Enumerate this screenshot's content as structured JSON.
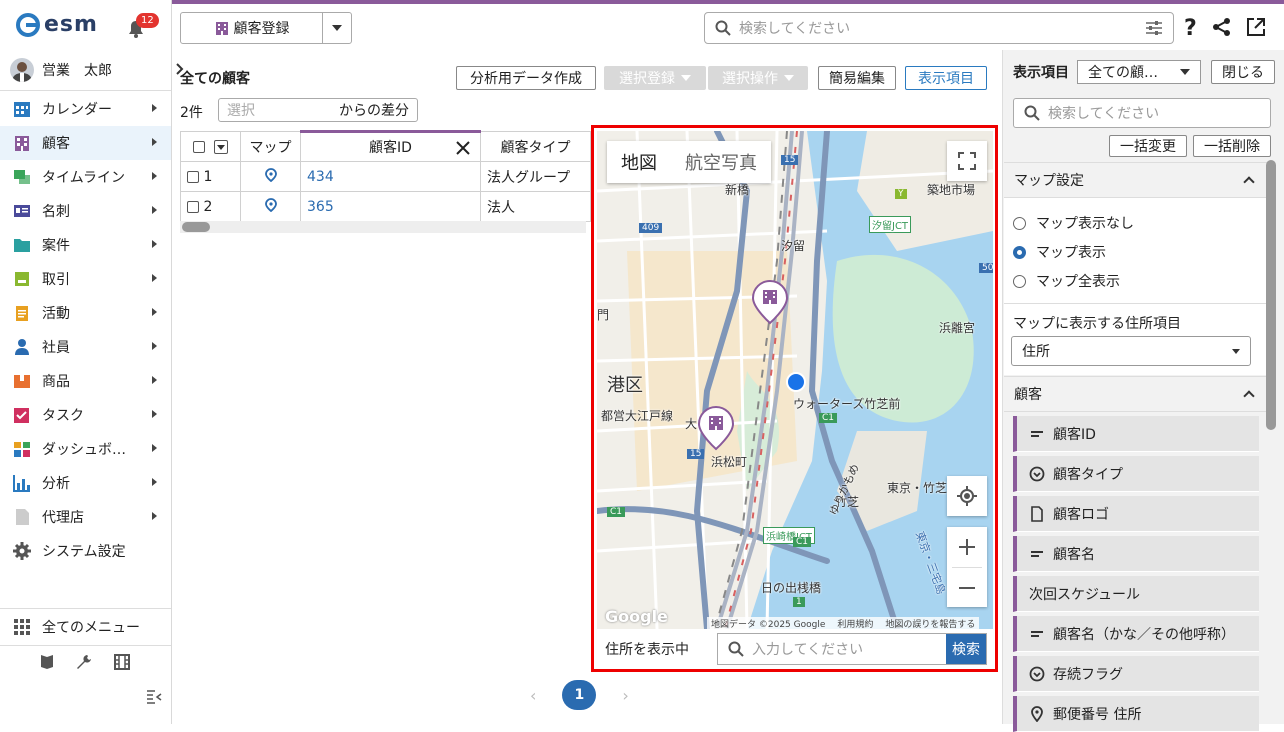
{
  "app": {
    "logo_text": "esm",
    "notifications": "12",
    "user_name": "営業　太郎"
  },
  "nav": [
    {
      "label": "カレンダー",
      "icon": "calendar-icon",
      "color": "#2a7ac0"
    },
    {
      "label": "顧客",
      "icon": "building-icon",
      "color": "#8a5a9a",
      "active": true
    },
    {
      "label": "タイムライン",
      "icon": "chat-icon",
      "color": "#3aa55a"
    },
    {
      "label": "名刺",
      "icon": "business-card-icon",
      "color": "#4a4a9a"
    },
    {
      "label": "案件",
      "icon": "folder-icon",
      "color": "#2aa0a0"
    },
    {
      "label": "取引",
      "icon": "deal-icon",
      "color": "#8ab830"
    },
    {
      "label": "活動",
      "icon": "clipboard-icon",
      "color": "#e8a020"
    },
    {
      "label": "社員",
      "icon": "person-icon",
      "color": "#2a6bb0"
    },
    {
      "label": "商品",
      "icon": "product-icon",
      "color": "#e87030"
    },
    {
      "label": "タスク",
      "icon": "task-icon",
      "color": "#d03060"
    },
    {
      "label": "ダッシュボ…",
      "icon": "dashboard-icon",
      "color": "#e8a020"
    },
    {
      "label": "分析",
      "icon": "chart-icon",
      "color": "#2a7ac0"
    },
    {
      "label": "代理店",
      "icon": "document-icon",
      "color": "#aaaaaa"
    },
    {
      "label": "システム設定",
      "icon": "gear-icon",
      "color": "#555555",
      "noarrow": true
    }
  ],
  "all_menu": "全てのメニュー",
  "toolbar": {
    "register": "顧客登録",
    "search_placeholder": "検索してください"
  },
  "list": {
    "title": "全ての顧客",
    "count": "2件",
    "diff_placeholder": "選択",
    "diff_label": "からの差分",
    "buttons": {
      "analysis": "分析用データ作成",
      "select_register": "選択登録",
      "select_operate": "選択操作",
      "quick_edit": "簡易編集",
      "display_items": "表示項目"
    },
    "columns": [
      "マップ",
      "顧客ID",
      "顧客タイプ"
    ],
    "rows": [
      {
        "no": "1",
        "id": "434",
        "type": "法人グループ"
      },
      {
        "no": "2",
        "id": "365",
        "type": "法人"
      }
    ]
  },
  "map": {
    "tab_map": "地図",
    "tab_satellite": "航空写真",
    "labels": {
      "ward": "港区",
      "shinbashi": "新橋",
      "shiodome": "汐留",
      "tsukiji": "築地市場",
      "shiodome_jct": "汐留JCT",
      "hamarikyu": "浜離宮",
      "waters": "ウォーターズ竹芝前",
      "hamamatsucho": "浜松町",
      "shibadaimon": "都営大江戸線",
      "takeshiba": "竹芝",
      "tokyo_takeshiba": "東京・竹芝",
      "hamazakibashi": "浜崎橋JCT",
      "yurikamome": "ゆりかもめ",
      "hinode": "日の出桟橋",
      "mon": "門",
      "dai": "大",
      "sanban": "東京・三宅島",
      "r409": "409",
      "r15a": "15",
      "r15b": "15",
      "r50": "50",
      "rc1a": "C1",
      "rc1b": "C1",
      "rc1c": "C1",
      "ry": "Y",
      "r1": "1"
    },
    "google": "Google",
    "attribution": "地図データ ©2025 Google",
    "terms": "利用規約",
    "report": "地図の誤りを報告する",
    "showing_label": "住所を表示中",
    "address_placeholder": "入力してください",
    "search_button": "検索"
  },
  "pager": {
    "current": "1"
  },
  "panel": {
    "title": "表示項目",
    "view_select": "全ての顧…",
    "close": "閉じる",
    "search_placeholder": "検索してください",
    "bulk_change": "一括変更",
    "bulk_delete": "一括削除",
    "map_settings": "マップ設定",
    "radios": [
      "マップ表示なし",
      "マップ表示",
      "マップ全表示"
    ],
    "address_field_label": "マップに表示する住所項目",
    "address_field_value": "住所",
    "customer_section": "顧客",
    "fields": [
      {
        "label": "顧客ID",
        "icon": "text-field-icon"
      },
      {
        "label": "顧客タイプ",
        "icon": "select-field-icon"
      },
      {
        "label": "顧客ロゴ",
        "icon": "file-field-icon"
      },
      {
        "label": "顧客名",
        "icon": "text-field-icon"
      },
      {
        "label": "次回スケジュール",
        "icon": ""
      },
      {
        "label": "顧客名（かな／その他呼称）",
        "icon": "text-field-icon"
      },
      {
        "label": "存続フラグ",
        "icon": "select-field-icon"
      },
      {
        "label": "郵便番号  住所",
        "icon": "location-icon"
      }
    ]
  }
}
